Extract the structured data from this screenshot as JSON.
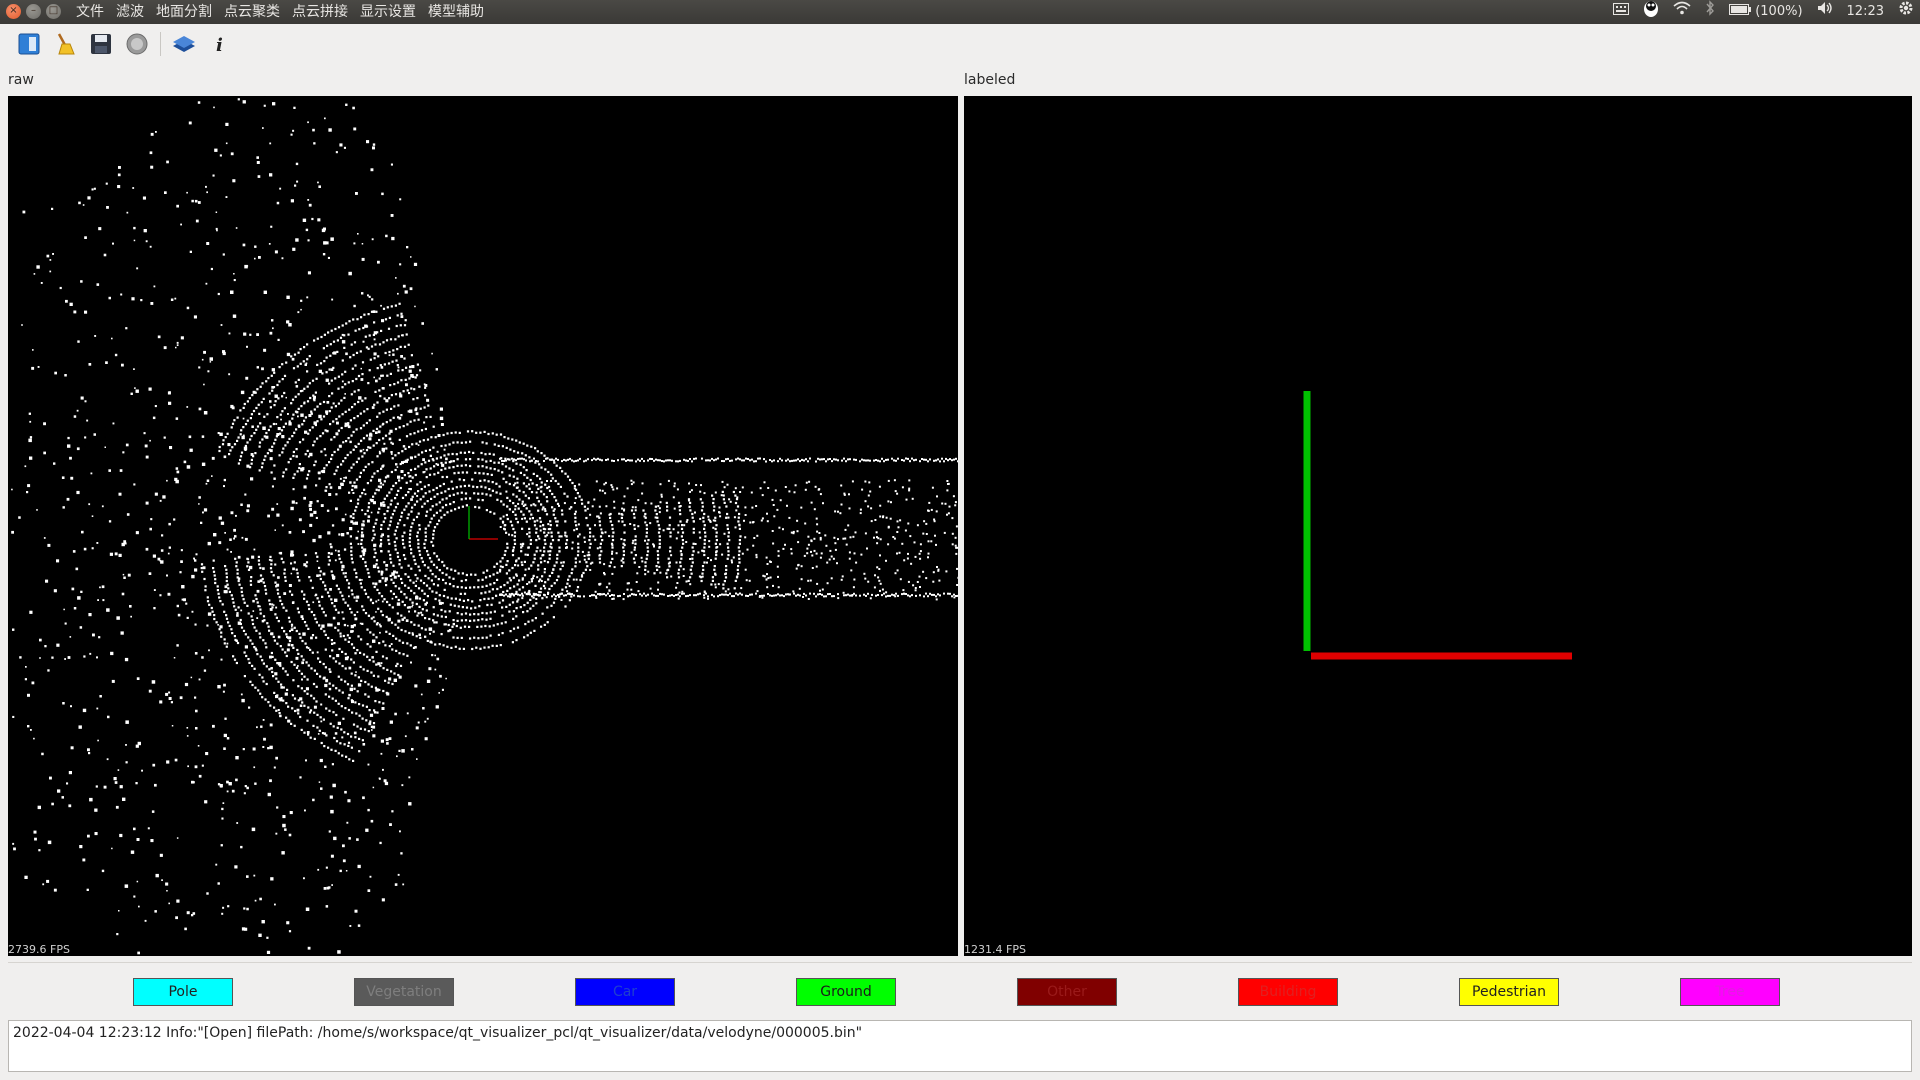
{
  "menubar": {
    "items": [
      {
        "label": "文件"
      },
      {
        "label": "滤波"
      },
      {
        "label": "地面分割"
      },
      {
        "label": "点云聚类"
      },
      {
        "label": "点云拼接"
      },
      {
        "label": "显示设置"
      },
      {
        "label": "模型辅助"
      }
    ]
  },
  "tray": {
    "battery": "(100%)",
    "clock": "12:23"
  },
  "toolbar": {
    "icons": [
      "open-file-icon",
      "clear-brush-icon",
      "save-icon",
      "record-icon",
      "layers-icon",
      "info-icon"
    ]
  },
  "panels": {
    "raw": {
      "label": "raw",
      "fps": "2739.6 FPS"
    },
    "labeled": {
      "label": "labeled",
      "fps": "1231.4 FPS"
    }
  },
  "axes_colors": {
    "x": "#e00000",
    "y": "#00c000",
    "z": "#0000ff"
  },
  "legend": [
    {
      "label": "Pole",
      "bg": "#00ffff",
      "fg": "#222222"
    },
    {
      "label": "Vegetation",
      "bg": "#5a5a5a",
      "fg": "#7e7e7e"
    },
    {
      "label": "Car",
      "bg": "#0000ff",
      "fg": "#1f3fd0"
    },
    {
      "label": "Ground",
      "bg": "#00ff00",
      "fg": "#1a1a1a"
    },
    {
      "label": "Other",
      "bg": "#800000",
      "fg": "#9a1a1a"
    },
    {
      "label": "Building",
      "bg": "#ff0000",
      "fg": "#e02020"
    },
    {
      "label": "Pedestrian",
      "bg": "#ffff00",
      "fg": "#222222"
    },
    {
      "label": "Tree",
      "bg": "#ff00ff",
      "fg": "#e01ee0"
    }
  ],
  "log": {
    "text": "2022-04-04 12:23:12 Info:\"[Open] filePath: /home/s/workspace/qt_visualizer_pcl/qt_visualizer/data/velodyne/000005.bin\""
  }
}
